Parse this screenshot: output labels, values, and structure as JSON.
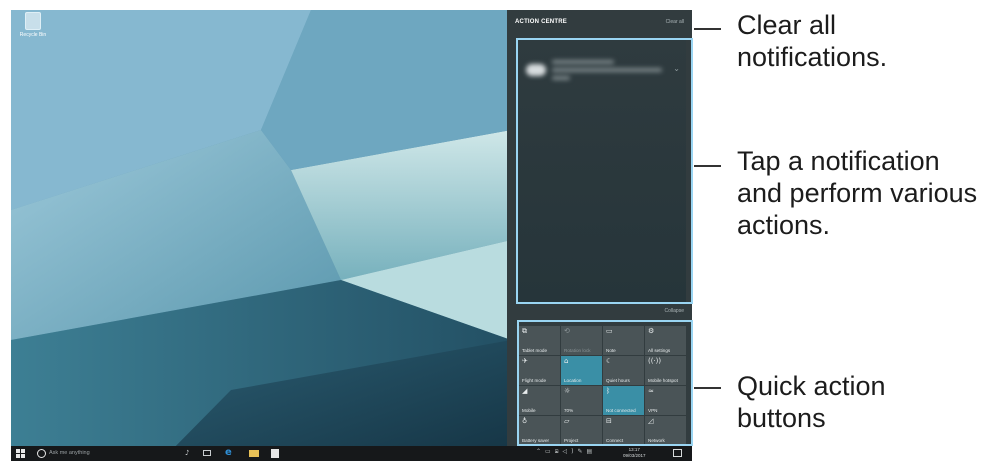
{
  "desktop": {
    "icon_label": "Recycle Bin"
  },
  "action_centre": {
    "title": "ACTION CENTRE",
    "clear_all": "Clear all",
    "collapse": "Collapse",
    "tiles": [
      {
        "label": "Tablet mode",
        "icon": "tablet-mode-icon",
        "glyph": "⧉",
        "state": "off"
      },
      {
        "label": "Rotation lock",
        "icon": "rotation-lock-icon",
        "glyph": "⟲",
        "state": "disabled"
      },
      {
        "label": "Note",
        "icon": "note-icon",
        "glyph": "▭",
        "state": "off"
      },
      {
        "label": "All settings",
        "icon": "settings-gear-icon",
        "glyph": "⚙",
        "state": "off"
      },
      {
        "label": "Flight mode",
        "icon": "airplane-icon",
        "glyph": "✈",
        "state": "off"
      },
      {
        "label": "Location",
        "icon": "location-icon",
        "glyph": "⌂",
        "state": "on"
      },
      {
        "label": "Quiet hours",
        "icon": "moon-icon",
        "glyph": "☾",
        "state": "off"
      },
      {
        "label": "Mobile hotspot",
        "icon": "hotspot-icon",
        "glyph": "((·))",
        "state": "off"
      },
      {
        "label": "Mobile",
        "icon": "signal-icon",
        "glyph": "◢",
        "state": "off"
      },
      {
        "label": "70%",
        "icon": "brightness-icon",
        "glyph": "☼",
        "state": "off"
      },
      {
        "label": "Not connected",
        "icon": "bluetooth-icon",
        "glyph": "ᛒ",
        "state": "on"
      },
      {
        "label": "VPN",
        "icon": "vpn-icon",
        "glyph": "≈",
        "state": "off"
      },
      {
        "label": "Battery saver",
        "icon": "battery-saver-icon",
        "glyph": "♁",
        "state": "off"
      },
      {
        "label": "Project",
        "icon": "project-icon",
        "glyph": "▱",
        "state": "off"
      },
      {
        "label": "Connect",
        "icon": "connect-icon",
        "glyph": "⊟",
        "state": "off"
      },
      {
        "label": "Network",
        "icon": "network-icon",
        "glyph": "◿",
        "state": "off"
      }
    ],
    "colors": {
      "panel": "#323c3f",
      "tile": "#4a5457",
      "tile_active": "#3a8fa6"
    }
  },
  "taskbar": {
    "search_placeholder": "Ask me anything",
    "clock_time": "13:17",
    "clock_date": "09/03/2017"
  },
  "callouts": {
    "clear_all": [
      "Clear all",
      "notifications."
    ],
    "notification": [
      "Tap a notification",
      "and perform various",
      "actions."
    ],
    "quick_action": [
      "Quick action",
      "buttons"
    ]
  },
  "highlight_color": "#9ad5f2"
}
